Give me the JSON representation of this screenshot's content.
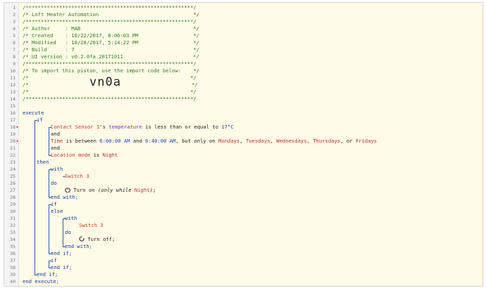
{
  "lines": [
    {
      "n": 1,
      "segs": [
        [
          "cm",
          "/*******************************************************/"
        ]
      ]
    },
    {
      "n": 2,
      "segs": [
        [
          "cm",
          "/* Loft Heater Automation                               */"
        ]
      ]
    },
    {
      "n": 3,
      "segs": [
        [
          "cm",
          "/*******************************************************/"
        ]
      ]
    },
    {
      "n": 4,
      "segs": [
        [
          "cm",
          "/* Author     : MAB                                     */"
        ]
      ]
    },
    {
      "n": 5,
      "segs": [
        [
          "cm",
          "/* Created    : 10/22/2017, 8:06:03 PM                  */"
        ]
      ]
    },
    {
      "n": 6,
      "segs": [
        [
          "cm",
          "/* Modified   : 10/28/2017, 5:14:22 PM                  */"
        ]
      ]
    },
    {
      "n": 7,
      "segs": [
        [
          "cm",
          "/* Build      : 7                                       */"
        ]
      ]
    },
    {
      "n": 8,
      "segs": [
        [
          "cm",
          "/* UI version : v0.2.0fa.20171011                       */"
        ]
      ]
    },
    {
      "n": 9,
      "segs": [
        [
          "cm",
          "/*******************************************************/"
        ]
      ]
    },
    {
      "n": 10,
      "segs": [
        [
          "cm",
          "/* To import this piston, use the import code below:    */"
        ]
      ]
    },
    {
      "n": 11,
      "segs": [
        [
          "cm",
          "/*                                                     */"
        ]
      ]
    },
    {
      "n": 12,
      "big": true,
      "segs": [
        [
          "cm",
          "/*"
        ],
        [
          "big",
          "vn0a"
        ],
        [
          "cm",
          "*/"
        ]
      ]
    },
    {
      "n": 13,
      "segs": [
        [
          "cm",
          "/*                                                     */"
        ]
      ]
    },
    {
      "n": 14,
      "segs": [
        [
          "cm",
          "/*******************************************************/"
        ]
      ]
    },
    {
      "n": 15,
      "segs": []
    },
    {
      "n": 16,
      "indent": 0,
      "segs": [
        [
          "kw",
          "execute"
        ]
      ]
    },
    {
      "n": 17,
      "indent": 1,
      "segs": [
        [
          "kw",
          "if"
        ]
      ]
    },
    {
      "n": 18,
      "indent": 2,
      "mark": true,
      "segs": [
        [
          "dev",
          "Contact Sensor 1"
        ],
        [
          "",
          "'s "
        ],
        [
          "attr",
          "temperature"
        ],
        [
          "",
          " is less than or equal to "
        ],
        [
          "val",
          "17°C"
        ]
      ]
    },
    {
      "n": 19,
      "indent": 2,
      "segs": [
        [
          "",
          "and"
        ]
      ]
    },
    {
      "n": 20,
      "indent": 2,
      "mark": true,
      "segs": [
        [
          "dev",
          "Time"
        ],
        [
          "",
          " is between "
        ],
        [
          "val",
          "6:00:00 AM"
        ],
        [
          "",
          " and "
        ],
        [
          "val",
          "6:40:00 AM"
        ],
        [
          "",
          ", but only on "
        ],
        [
          "day",
          "Mondays"
        ],
        [
          "",
          ", "
        ],
        [
          "day",
          "Tuesdays"
        ],
        [
          "",
          ", "
        ],
        [
          "day",
          "Wednesdays"
        ],
        [
          "",
          ", "
        ],
        [
          "day",
          "Thursdays"
        ],
        [
          "",
          ", or "
        ],
        [
          "day",
          "Fridays"
        ]
      ]
    },
    {
      "n": 21,
      "indent": 2,
      "segs": [
        [
          "",
          "and"
        ]
      ]
    },
    {
      "n": 22,
      "indent": 2,
      "segs": [
        [
          "dev",
          "Location mode"
        ],
        [
          "",
          " is "
        ],
        [
          "day",
          "Night"
        ]
      ]
    },
    {
      "n": 23,
      "indent": 1,
      "segs": [
        [
          "kw",
          "then"
        ]
      ]
    },
    {
      "n": 24,
      "indent": 2,
      "segs": [
        [
          "kw",
          "with"
        ]
      ]
    },
    {
      "n": 25,
      "indent": 3,
      "segs": [
        [
          "dev",
          "Switch 3"
        ]
      ]
    },
    {
      "n": 26,
      "indent": 2,
      "segs": [
        [
          "kw",
          "do"
        ]
      ]
    },
    {
      "n": 27,
      "indent": 3,
      "icon": "power",
      "segs": [
        [
          "",
          "Turn on "
        ],
        [
          "it",
          "(only while "
        ],
        [
          "day",
          "Night"
        ],
        [
          "it",
          ")"
        ],
        [
          "",
          ";"
        ]
      ]
    },
    {
      "n": 28,
      "indent": 2,
      "segs": [
        [
          "kw",
          "end with;"
        ]
      ]
    },
    {
      "n": 29,
      "indent": 2,
      "segs": [
        [
          "kw",
          "if"
        ]
      ]
    },
    {
      "n": 30,
      "indent": 2,
      "segs": [
        [
          "kw",
          "else"
        ]
      ]
    },
    {
      "n": 31,
      "indent": 3,
      "segs": [
        [
          "kw",
          "with"
        ]
      ]
    },
    {
      "n": 32,
      "indent": 4,
      "segs": [
        [
          "dev",
          "Switch 3"
        ]
      ]
    },
    {
      "n": 33,
      "indent": 3,
      "segs": [
        [
          "kw",
          "do"
        ]
      ]
    },
    {
      "n": 34,
      "indent": 4,
      "icon": "off",
      "segs": [
        [
          "",
          "Turn off;"
        ]
      ]
    },
    {
      "n": 35,
      "indent": 3,
      "segs": [
        [
          "kw",
          "end with;"
        ]
      ]
    },
    {
      "n": 36,
      "indent": 2,
      "segs": [
        [
          "kw",
          "end if;"
        ]
      ]
    },
    {
      "n": 37,
      "indent": 2,
      "segs": [
        [
          "kw",
          "if"
        ]
      ]
    },
    {
      "n": 38,
      "indent": 2,
      "segs": [
        [
          "kw",
          "end if;"
        ]
      ]
    },
    {
      "n": 39,
      "indent": 1,
      "segs": [
        [
          "kw",
          "end if;"
        ]
      ]
    },
    {
      "n": 40,
      "indent": 0,
      "segs": [
        [
          "kw",
          "end execute;"
        ]
      ]
    }
  ]
}
